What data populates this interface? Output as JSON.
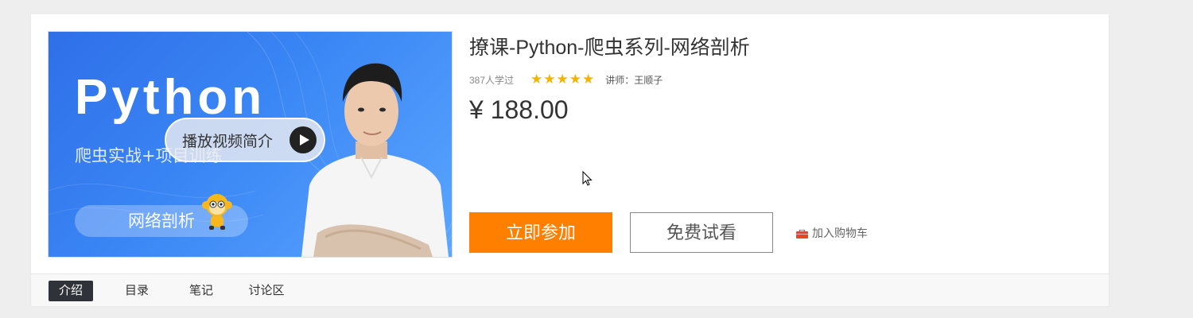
{
  "cover": {
    "title": "Python",
    "subtitle": "爬虫实战+项目训练",
    "tag": "网络剖析",
    "video_button_label": "播放视频简介",
    "play_icon": "play-icon",
    "gradient_start": "#2f6fe8",
    "gradient_end": "#5aa6ff"
  },
  "course": {
    "title": "撩课-Python-爬虫系列-网络剖析",
    "learners": "387人学过",
    "rating": 5,
    "teacher": "讲师：王顺子",
    "price": "¥ 188.00"
  },
  "actions": {
    "join_label": "立即参加",
    "free_trial_label": "免费试看",
    "cart_label": "加入购物车",
    "cart_icon": "cart-icon",
    "join_color": "#ff7f00"
  },
  "tabs": [
    {
      "label": "介绍",
      "active": true
    },
    {
      "label": "目录",
      "active": false
    },
    {
      "label": "笔记",
      "active": false
    },
    {
      "label": "讨论区",
      "active": false
    }
  ]
}
